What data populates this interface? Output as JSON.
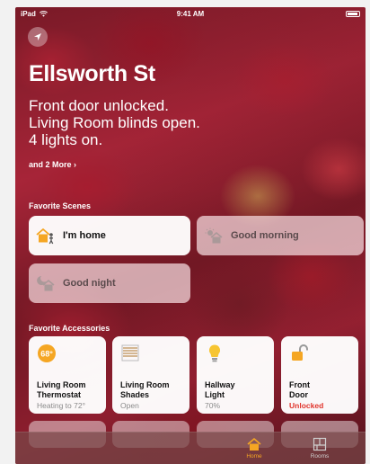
{
  "status_bar": {
    "carrier": "iPad",
    "time": "9:41 AM"
  },
  "home": {
    "title": "Ellsworth St",
    "summary": [
      "Front door unlocked.",
      "Living Room blinds open.",
      "4 lights on."
    ],
    "more_link": "and 2 More ›"
  },
  "sections": {
    "scenes": "Favorite Scenes",
    "accessories": "Favorite Accessories"
  },
  "scenes": [
    {
      "label": "I'm home",
      "active": true,
      "icon": "home-person-icon"
    },
    {
      "label": "Good morning",
      "active": false,
      "icon": "sunrise-house-icon"
    },
    {
      "label": "Good night",
      "active": false,
      "icon": "moon-house-icon"
    }
  ],
  "accessories": [
    {
      "line1": "Living Room",
      "line2": "Thermostat",
      "state": "Heating to 72°",
      "badge": "68°",
      "icon": "thermostat-icon",
      "alert": false
    },
    {
      "line1": "Living Room",
      "line2": "Shades",
      "state": "Open",
      "icon": "shades-icon",
      "alert": false
    },
    {
      "line1": "Hallway",
      "line2": "Light",
      "state": "70%",
      "icon": "lightbulb-icon",
      "alert": false
    },
    {
      "line1": "Front",
      "line2": "Door",
      "state": "Unlocked",
      "icon": "unlocked-padlock-icon",
      "alert": true
    }
  ],
  "tabs": [
    {
      "label": "Home",
      "icon": "home-tab-icon",
      "selected": true
    },
    {
      "label": "Rooms",
      "icon": "rooms-tab-icon",
      "selected": false
    }
  ],
  "colors": {
    "accent": "#f5a623",
    "alert": "#e0342c",
    "tile_bg": "#ffffff"
  }
}
